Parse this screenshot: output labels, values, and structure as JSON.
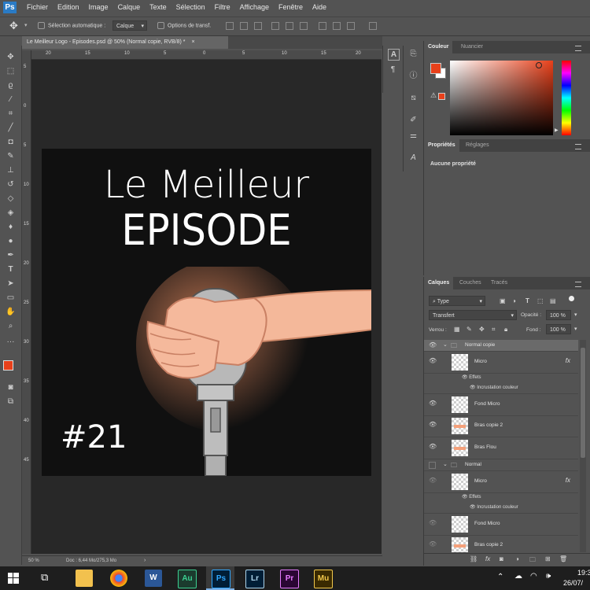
{
  "app": {
    "logo": "Ps"
  },
  "menu": [
    "Fichier",
    "Edition",
    "Image",
    "Calque",
    "Texte",
    "Sélection",
    "Filtre",
    "Affichage",
    "Fenêtre",
    "Aide"
  ],
  "options_bar": {
    "auto_select_label": "Sélection automatique :",
    "auto_select_value": "Calque",
    "transform_label": "Options de transf."
  },
  "document": {
    "tab_title": "Le Meilleur Logo - Episodes.psd @ 50% (Normal copie, RVB/8) *",
    "tab_close": "×",
    "zoom": "50 %",
    "doc_info": "Doc : 6,44 Mo/275,3 Mo",
    "artwork": {
      "line1": "Le Meilleur",
      "line2": "EPISODE",
      "episode": "#21"
    },
    "ruler_h": [
      "20",
      "15",
      "10",
      "5",
      "0",
      "5",
      "10",
      "15",
      "20"
    ],
    "ruler_v": [
      "5",
      "0",
      "5",
      "10",
      "15",
      "20",
      "25",
      "30",
      "35",
      "40",
      "45"
    ]
  },
  "color_panel": {
    "tab_active": "Couleur",
    "tab_other": "Nuancier",
    "fg_color": "#e8401a",
    "bg_color": "#ffffff"
  },
  "properties_panel": {
    "tab_active": "Propriétés",
    "tab_other": "Réglages",
    "empty_text": "Aucune propriété"
  },
  "layers_panel": {
    "tabs": [
      "Calques",
      "Couches",
      "Tracés"
    ],
    "filter_value": "Type",
    "blend_mode": "Transfert",
    "opacity_label": "Opacité :",
    "opacity_value": "100 %",
    "lock_label": "Verrou :",
    "fill_label": "Fond :",
    "fill_value": "100 %",
    "fx_label": "fx",
    "layers": [
      {
        "name": "Normal copie",
        "type": "group"
      },
      {
        "name": "Micro",
        "type": "layer",
        "fx": true
      },
      {
        "name": "Effets",
        "type": "effects"
      },
      {
        "name": "Incrustation couleur",
        "type": "effect"
      },
      {
        "name": "Fond Micro",
        "type": "layer"
      },
      {
        "name": "Bras copie 2",
        "type": "layer"
      },
      {
        "name": "Bras Flou",
        "type": "layer"
      },
      {
        "name": "Normal",
        "type": "group"
      },
      {
        "name": "Micro",
        "type": "layer",
        "fx": true
      },
      {
        "name": "Effets",
        "type": "effects"
      },
      {
        "name": "Incrustation couleur",
        "type": "effect"
      },
      {
        "name": "Fond Micro",
        "type": "layer"
      },
      {
        "name": "Bras copie 2",
        "type": "layer"
      }
    ]
  },
  "taskbar": {
    "apps": [
      "Au",
      "Ps",
      "Lr",
      "Pr",
      "Mu"
    ],
    "time": "19:3",
    "date": "26/07/"
  }
}
